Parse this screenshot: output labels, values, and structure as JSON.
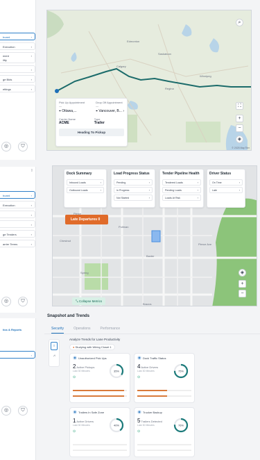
{
  "top_strip": {
    "items": [
      "board",
      "Execution",
      "ment\nility",
      "",
      "ge Bids",
      "ettings"
    ],
    "active_index": 0
  },
  "route_card": {
    "pickup_label": "Pick Up Appointment",
    "pickup_sub": "—",
    "pickup_city": "Ottawa,...",
    "dropoff_label": "Drop Off Appointment",
    "dropoff_sub": "—",
    "dropoff_city": "Vancouver, B...",
    "carrier_label": "Carrier Name",
    "carrier_value": "ACME",
    "type_label": "Type",
    "type_value": "Trailer",
    "button": "Heading To Pickup"
  },
  "map1": {
    "labels": [
      "Edmonton",
      "Calgary",
      "Winnipeg",
      "Regina",
      "Saskatoon"
    ],
    "attribution": "© 2025 MapTiler"
  },
  "mid_strip": {
    "items": [
      "board",
      "Execution",
      "",
      "",
      "ge Tenders",
      "arrier Terms"
    ],
    "active_index": 0
  },
  "dashboard": {
    "panels": [
      {
        "title": "Dock Summary",
        "rows": [
          "Inbound Loads",
          "Outbound Loads"
        ]
      },
      {
        "title": "Load Progress Status",
        "rows": [
          "Pending",
          "In Progress",
          "Not Started"
        ]
      },
      {
        "title": "Tender Pipeline Health",
        "rows": [
          "Tendered Loads",
          "Pending Loads",
          "Loads At Risk"
        ]
      },
      {
        "title": "Driver Status",
        "rows": [
          "On Time",
          "Late"
        ]
      }
    ],
    "late_badge": "Late Departures 0",
    "collapse_button": "Collapse Metrics",
    "map_labels": [
      "Pierce",
      "Pullman",
      "Chestnut",
      "Baxter",
      "Spring",
      "Pierce Ave",
      "Brazos"
    ]
  },
  "bottom_strip": {
    "items": [
      "",
      "",
      "",
      "",
      "",
      "",
      "",
      "tics & Reports"
    ],
    "active_index": 8
  },
  "snapshot": {
    "title": "Snapshot and Trends",
    "tabs": [
      "Security",
      "Operations",
      "Performance"
    ],
    "active_tab": 0,
    "analyze_label": "Analyze Trends for Lane Productivity",
    "filter_chip": "Studying with Wiring Closet  1",
    "metrics": [
      {
        "title": "Unauthorized Pick Ups",
        "count": "2",
        "sub": "Active Pickups",
        "time": "Last 30 Minutes",
        "gauge_pct": 0.35,
        "gauge_text": "35%",
        "bar_color": "#d97a3a",
        "bar_pct": 0.95
      },
      {
        "title": "Dock Traffic Status",
        "count": "4",
        "sub": "Active Drivers",
        "time": "Last 30 Minutes",
        "gauge_pct": 0.75,
        "gauge_text": "75%",
        "bar_color": "#d97a3a",
        "bar_pct": 0.55
      },
      {
        "title": "Trailers In Safe Zone",
        "count": "1",
        "sub": "Active Drivers",
        "time": "Last 30 Minutes",
        "gauge_pct": 0.4,
        "gauge_text": "40%",
        "bar_color": "#2aa37a",
        "bar_pct": 0.0
      },
      {
        "title": "Trucker Backup",
        "count": "5",
        "sub": "Trailers Detected",
        "time": "Last 30 Minutes",
        "gauge_pct": 0.76,
        "gauge_text": "76%",
        "bar_color": "#2aa37a",
        "bar_pct": 0.0
      }
    ]
  },
  "colors": {
    "accent": "#1d6fb8",
    "route": "#1b6b6a",
    "late_badge": "#e06b2a",
    "gauge": "#1b7a7a"
  }
}
